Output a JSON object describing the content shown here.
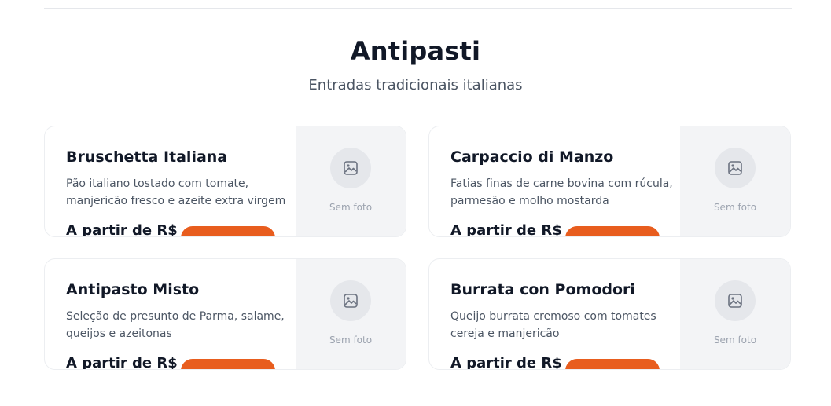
{
  "section": {
    "title": "Antipasti",
    "subtitle": "Entradas tradicionais italianas"
  },
  "items": [
    {
      "name": "Bruschetta Italiana",
      "description": "Pão italiano tostado com tomate, manjericão fresco e azeite extra virgem",
      "price_label": "A partir de R$",
      "no_photo_label": "Sem foto",
      "image_icon": "image-icon"
    },
    {
      "name": "Carpaccio di Manzo",
      "description": "Fatias finas de carne bovina com rúcula, parmesão e molho mostarda",
      "price_label": "A partir de R$",
      "no_photo_label": "Sem foto",
      "image_icon": "image-icon"
    },
    {
      "name": "Antipasto Misto",
      "description": "Seleção de presunto de Parma, salame, queijos e azeitonas",
      "price_label": "A partir de R$",
      "no_photo_label": "Sem foto",
      "image_icon": "image-icon"
    },
    {
      "name": "Burrata con Pomodori",
      "description": "Queijo burrata cremoso com tomates cereja e manjericão",
      "price_label": "A partir de R$",
      "no_photo_label": "Sem foto",
      "image_icon": "image-icon"
    }
  ],
  "colors": {
    "accent": "#e85d1e",
    "title": "#111827",
    "muted": "#4b5563",
    "placeholder_bg": "#f3f4f6"
  }
}
